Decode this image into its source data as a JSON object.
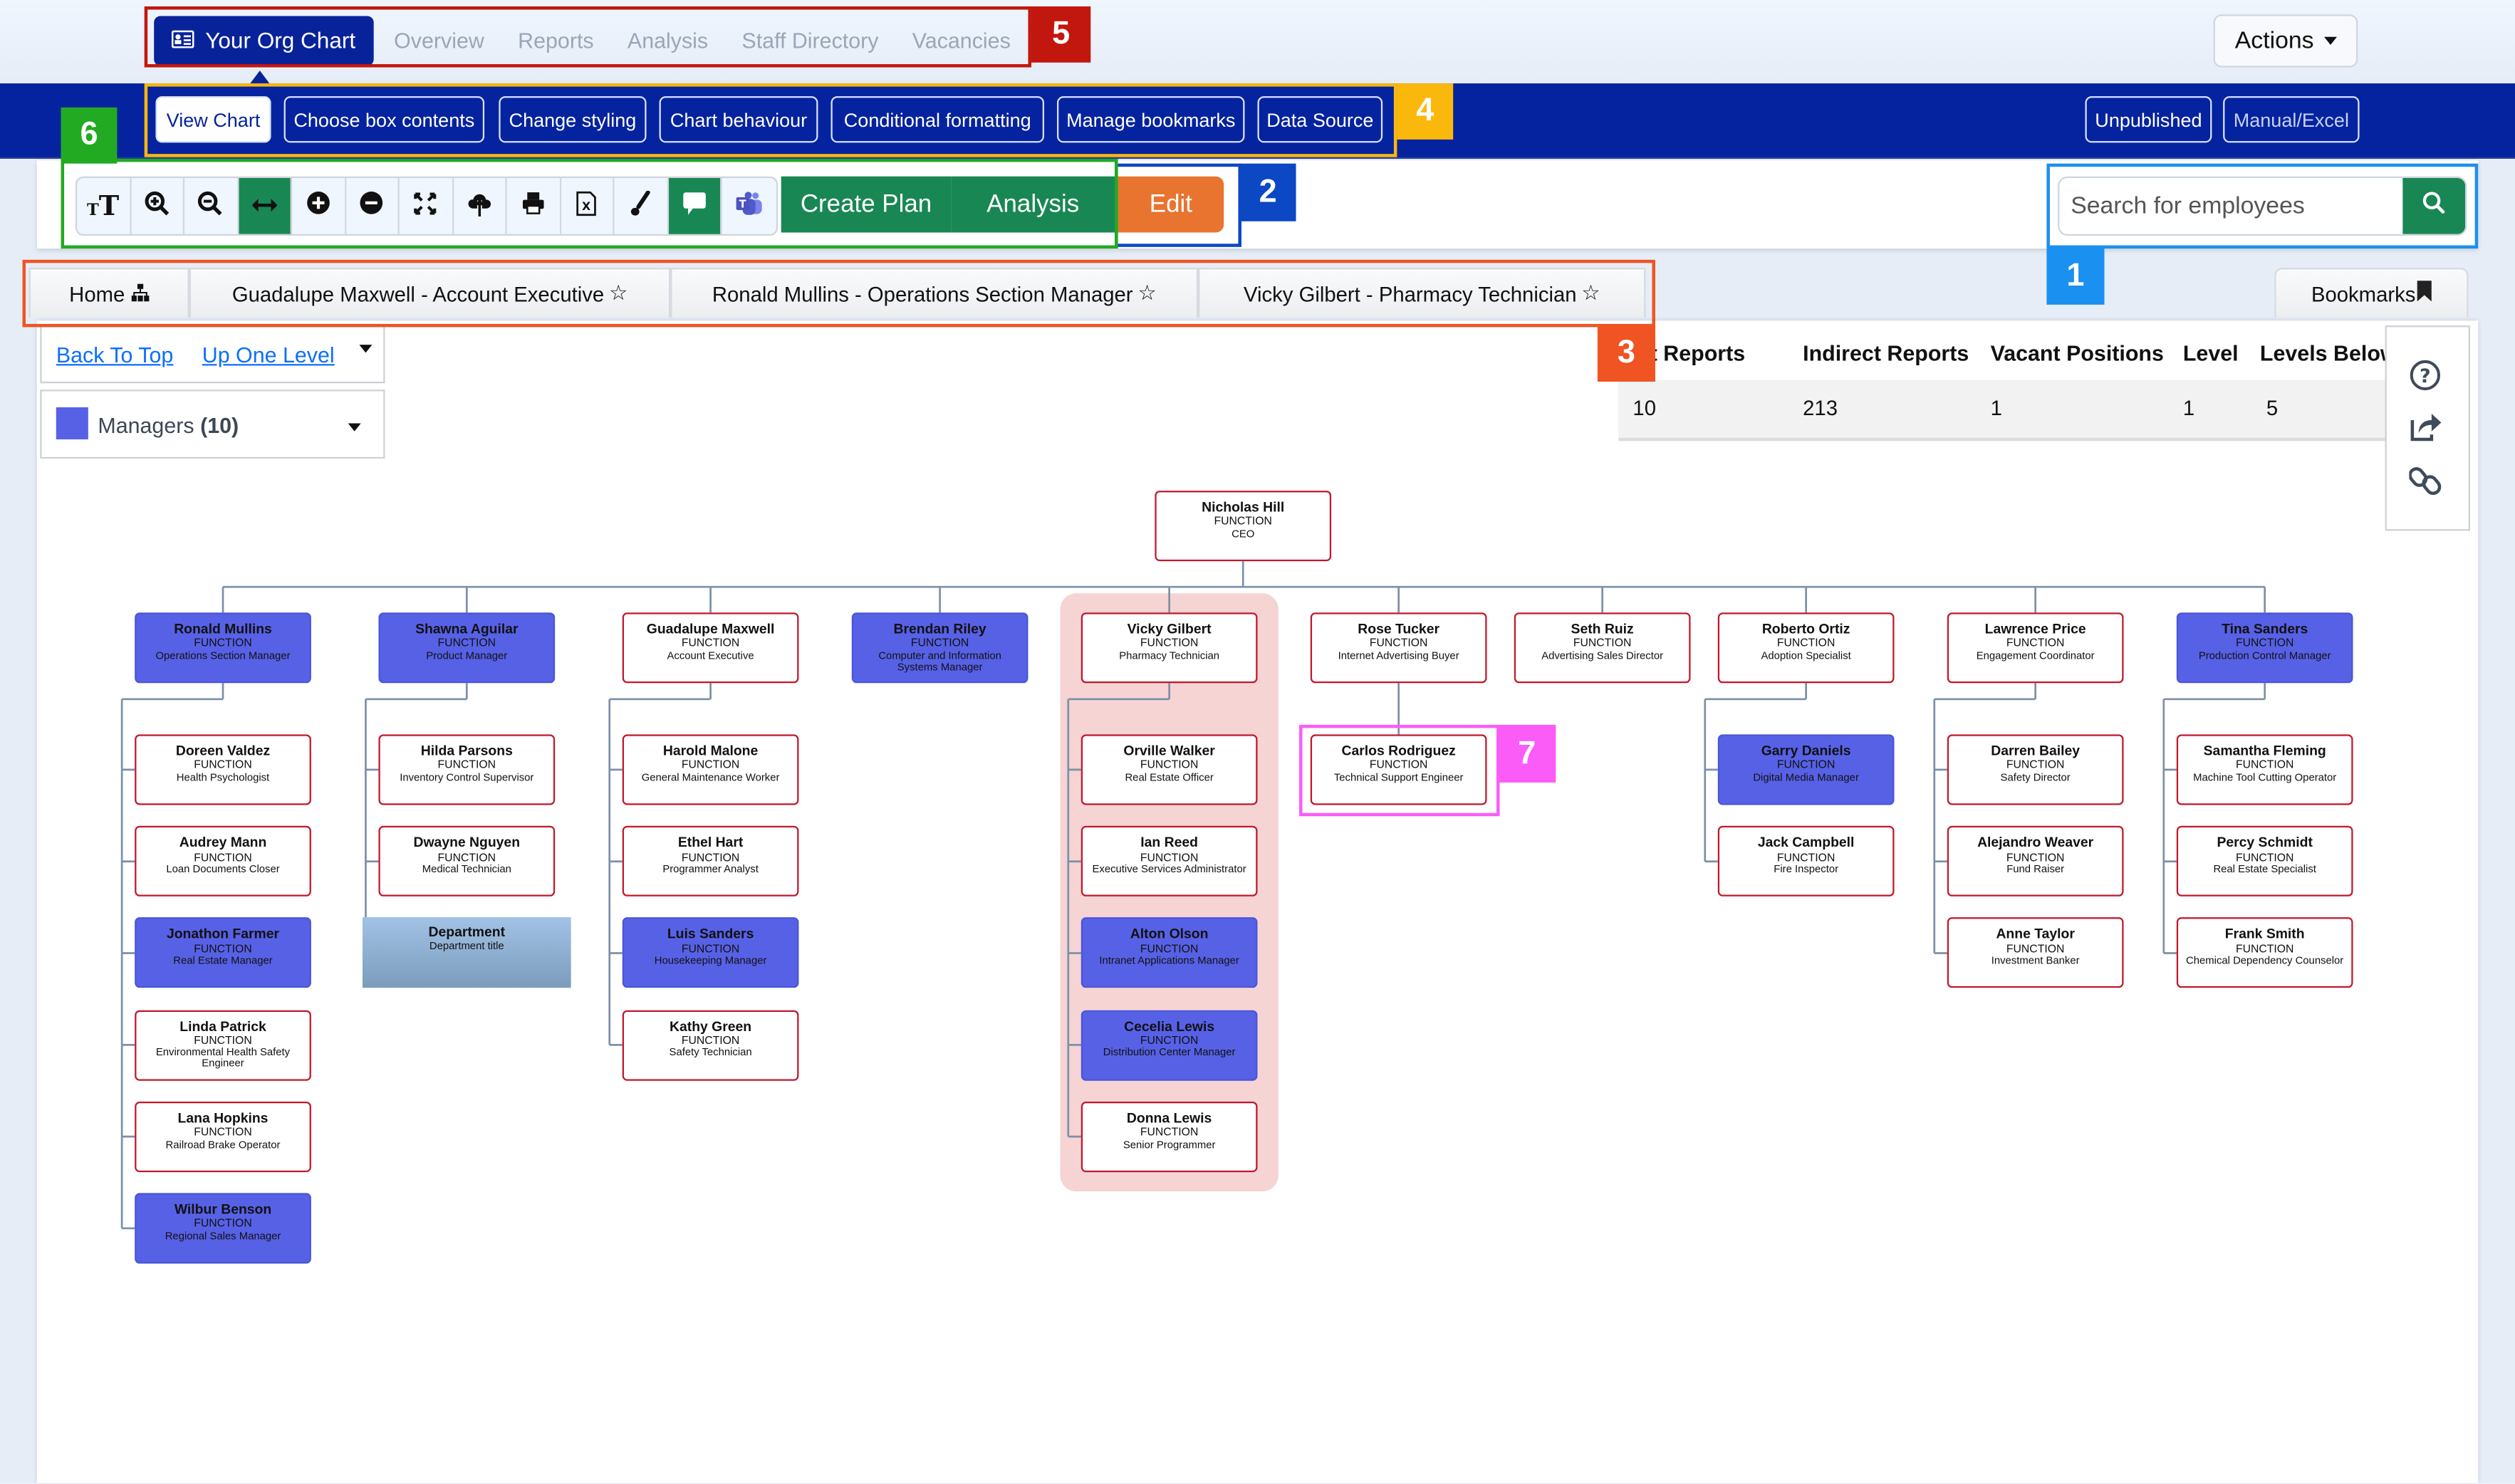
{
  "top_nav": {
    "active_tab": {
      "label": "Your Org Chart",
      "icon": "id-card-icon"
    },
    "tabs": [
      "Overview",
      "Reports",
      "Analysis",
      "Staff Directory",
      "Vacancies"
    ],
    "actions_label": "Actions"
  },
  "sub_nav": {
    "buttons": [
      "View Chart",
      "Choose box contents",
      "Change styling",
      "Chart behaviour",
      "Conditional formatting",
      "Manage bookmarks",
      "Data Source"
    ],
    "active_index": 0,
    "status_buttons": [
      "Unpublished",
      "Manual/Excel"
    ]
  },
  "toolbar": {
    "icons": [
      "text-size-icon",
      "zoom-in-icon",
      "zoom-out-icon",
      "fit-width-icon",
      "expand-icon",
      "collapse-icon",
      "fullscreen-icon",
      "upload-cloud-icon",
      "print-icon",
      "excel-export-icon",
      "paint-brush-icon",
      "comment-icon",
      "teams-icon"
    ],
    "create_plan_label": "Create Plan",
    "analysis_label": "Analysis",
    "edit_label": "Edit"
  },
  "search": {
    "placeholder": "Search for employees",
    "value": ""
  },
  "bookmark_tabs": [
    {
      "label": "Home",
      "icon": "sitemap-icon"
    },
    {
      "label": "Guadalupe Maxwell - Account Executive",
      "icon": "star-icon"
    },
    {
      "label": "Ronald Mullins - Operations Section Manager",
      "icon": "star-icon"
    },
    {
      "label": "Vicky Gilbert - Pharmacy Technician",
      "icon": "star-icon"
    }
  ],
  "bookmarks_label": "Bookmarks",
  "chart_nav": {
    "back_to_top": "Back To Top",
    "up_one_level": "Up One Level"
  },
  "legend": {
    "label": "Managers",
    "count": "(10)",
    "color": "#5761e6"
  },
  "stats": {
    "headers": [
      "Direct Reports",
      "Indirect Reports",
      "Vacant Positions",
      "Level",
      "Levels Below"
    ],
    "values": [
      "10",
      "213",
      "1",
      "1",
      "5"
    ]
  },
  "side_icons": [
    "help-icon",
    "share-icon",
    "link-icon"
  ],
  "callouts": [
    "1",
    "2",
    "3",
    "4",
    "5",
    "6",
    "7"
  ],
  "org": {
    "root": {
      "name": "Nicholas Hill",
      "function": "FUNCTION",
      "title": "CEO",
      "type": "norm"
    },
    "columns": [
      {
        "head": {
          "name": "Ronald Mullins",
          "function": "FUNCTION",
          "title": "Operations Section Manager",
          "type": "mgr"
        },
        "children": [
          {
            "name": "Doreen Valdez",
            "function": "FUNCTION",
            "title": "Health Psychologist",
            "type": "norm"
          },
          {
            "name": "Audrey Mann",
            "function": "FUNCTION",
            "title": "Loan Documents Closer",
            "type": "norm"
          },
          {
            "name": "Jonathon Farmer",
            "function": "FUNCTION",
            "title": "Real Estate Manager",
            "type": "mgr"
          },
          {
            "name": "Linda Patrick",
            "function": "FUNCTION",
            "title": "Environmental Health Safety Engineer",
            "type": "norm"
          },
          {
            "name": "Lana Hopkins",
            "function": "FUNCTION",
            "title": "Railroad Brake Operator",
            "type": "norm"
          },
          {
            "name": "Wilbur Benson",
            "function": "FUNCTION",
            "title": "Regional Sales Manager",
            "type": "mgr"
          }
        ]
      },
      {
        "head": {
          "name": "Shawna Aguilar",
          "function": "FUNCTION",
          "title": "Product Manager",
          "type": "mgr"
        },
        "children": [
          {
            "name": "Hilda Parsons",
            "function": "FUNCTION",
            "title": "Inventory Control Supervisor",
            "type": "norm"
          },
          {
            "name": "Dwayne Nguyen",
            "function": "FUNCTION",
            "title": "Medical Technician",
            "type": "norm"
          },
          {
            "name": "Department",
            "function": "",
            "title": "Department title",
            "type": "dept"
          }
        ]
      },
      {
        "head": {
          "name": "Guadalupe Maxwell",
          "function": "FUNCTION",
          "title": "Account Executive",
          "type": "norm"
        },
        "children": [
          {
            "name": "Harold Malone",
            "function": "FUNCTION",
            "title": "General Maintenance Worker",
            "type": "norm"
          },
          {
            "name": "Ethel Hart",
            "function": "FUNCTION",
            "title": "Programmer Analyst",
            "type": "norm"
          },
          {
            "name": "Luis Sanders",
            "function": "FUNCTION",
            "title": "Housekeeping Manager",
            "type": "mgr"
          },
          {
            "name": "Kathy Green",
            "function": "FUNCTION",
            "title": "Safety Technician",
            "type": "norm"
          }
        ]
      },
      {
        "head": {
          "name": "Brendan Riley",
          "function": "FUNCTION",
          "title": "Computer and Information Systems Manager",
          "type": "mgr"
        },
        "children": []
      },
      {
        "head": {
          "name": "Vicky Gilbert",
          "function": "FUNCTION",
          "title": "Pharmacy Technician",
          "type": "norm"
        },
        "highlighted": true,
        "children": [
          {
            "name": "Orville Walker",
            "function": "FUNCTION",
            "title": "Real Estate Officer",
            "type": "norm"
          },
          {
            "name": "Ian Reed",
            "function": "FUNCTION",
            "title": "Executive Services Administrator",
            "type": "norm"
          },
          {
            "name": "Alton Olson",
            "function": "FUNCTION",
            "title": "Intranet Applications Manager",
            "type": "mgr"
          },
          {
            "name": "Cecelia Lewis",
            "function": "FUNCTION",
            "title": "Distribution Center Manager",
            "type": "mgr"
          },
          {
            "name": "Donna Lewis",
            "function": "FUNCTION",
            "title": "Senior Programmer",
            "type": "norm"
          }
        ]
      },
      {
        "head": {
          "name": "Rose Tucker",
          "function": "FUNCTION",
          "title": "Internet Advertising Buyer",
          "type": "norm"
        },
        "single_child": true,
        "children": [
          {
            "name": "Carlos Rodriguez",
            "function": "FUNCTION",
            "title": "Technical Support Engineer",
            "type": "norm"
          }
        ]
      },
      {
        "head": {
          "name": "Seth Ruiz",
          "function": "FUNCTION",
          "title": "Advertising Sales Director",
          "type": "norm"
        },
        "children": []
      },
      {
        "head": {
          "name": "Roberto Ortiz",
          "function": "FUNCTION",
          "title": "Adoption Specialist",
          "type": "norm"
        },
        "children": [
          {
            "name": "Garry Daniels",
            "function": "FUNCTION",
            "title": "Digital Media Manager",
            "type": "mgr"
          },
          {
            "name": "Jack Campbell",
            "function": "FUNCTION",
            "title": "Fire Inspector",
            "type": "norm"
          }
        ]
      },
      {
        "head": {
          "name": "Lawrence Price",
          "function": "FUNCTION",
          "title": "Engagement Coordinator",
          "type": "norm"
        },
        "children": [
          {
            "name": "Darren Bailey",
            "function": "FUNCTION",
            "title": "Safety Director",
            "type": "norm"
          },
          {
            "name": "Alejandro Weaver",
            "function": "FUNCTION",
            "title": "Fund Raiser",
            "type": "norm"
          },
          {
            "name": "Anne Taylor",
            "function": "FUNCTION",
            "title": "Investment Banker",
            "type": "norm"
          }
        ]
      },
      {
        "head": {
          "name": "Tina Sanders",
          "function": "FUNCTION",
          "title": "Production Control Manager",
          "type": "mgr"
        },
        "children": [
          {
            "name": "Samantha Fleming",
            "function": "FUNCTION",
            "title": "Machine Tool Cutting Operator",
            "type": "norm"
          },
          {
            "name": "Percy Schmidt",
            "function": "FUNCTION",
            "title": "Real Estate Specialist",
            "type": "norm"
          },
          {
            "name": "Frank Smith",
            "function": "FUNCTION",
            "title": "Chemical Dependency Counselor",
            "type": "norm"
          }
        ]
      }
    ]
  }
}
